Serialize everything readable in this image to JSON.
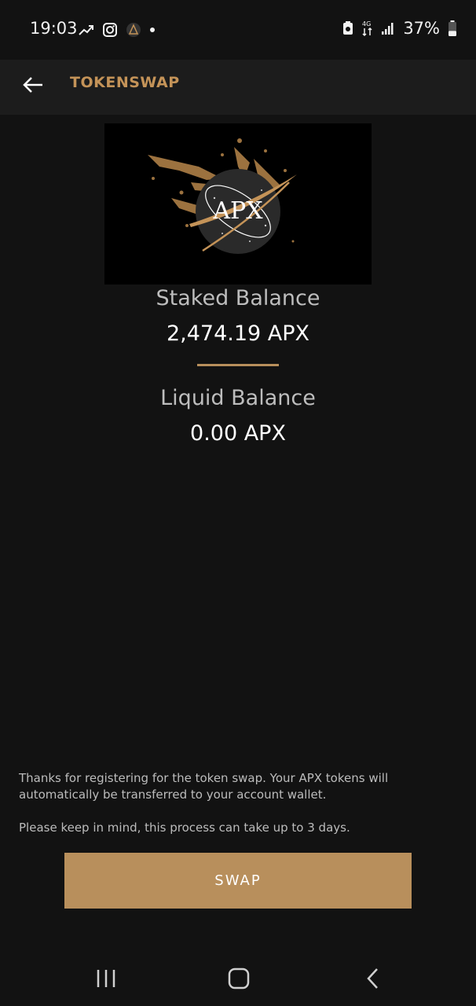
{
  "status_bar": {
    "time": "19:03",
    "battery_percent": "37%",
    "battery_level": 0.37,
    "left_icons": [
      "trending-icon",
      "instagram-icon",
      "app-notification-icon",
      "dot-icon"
    ],
    "right_icons": [
      "saver-icon",
      "data-icon",
      "signal-icon",
      "battery-icon"
    ],
    "data_label": "4G"
  },
  "app_bar": {
    "title": "TOKENSWAP",
    "back_icon": "arrow-left-icon"
  },
  "logo": {
    "text": "APX"
  },
  "balances": {
    "staked_label": "Staked Balance",
    "staked_value": "2,474.19 APX",
    "liquid_label": "Liquid Balance",
    "liquid_value": "0.00 APX"
  },
  "notice": {
    "line1": "Thanks for registering for the token swap. Your APX tokens will automatically be transferred to your account wallet.",
    "line2": "Please keep in mind, this process can take up to 3 days."
  },
  "swap_button": {
    "label": "SWAP"
  },
  "nav_bar": {
    "items": [
      "recent-apps-icon",
      "home-icon",
      "back-icon"
    ]
  },
  "colors": {
    "accent": "#c49358",
    "button": "#b88f5c",
    "background": "#121212",
    "app_bar": "#1c1c1c"
  }
}
